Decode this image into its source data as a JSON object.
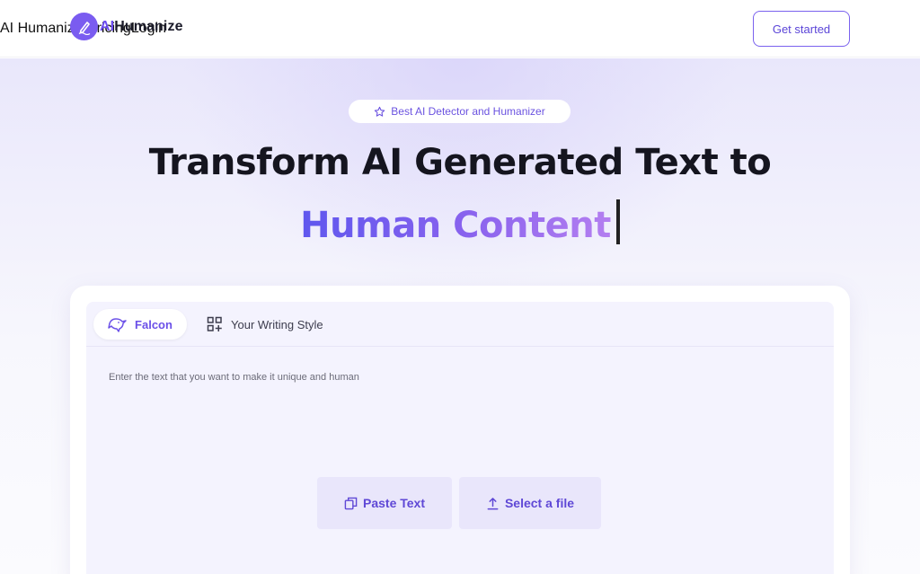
{
  "brand": {
    "name_prefix": "AI",
    "name_suffix": "Humanize"
  },
  "nav": {
    "items": [
      "AI Humanizer",
      "Pricing",
      "Login"
    ],
    "cta_label": "Get started"
  },
  "hero": {
    "badge_label": "Best AI Detector and Humanizer",
    "title_line1": "Transform AI Generated Text to",
    "title_line2": "Human Content"
  },
  "editor": {
    "tabs": [
      {
        "label": "Falcon",
        "icon": "falcon-icon",
        "active": true
      },
      {
        "label": "Your Writing Style",
        "icon": "grid-plus-icon",
        "active": false
      }
    ],
    "placeholder": "Enter the text that you want to make it unique and human",
    "actions": {
      "paste_label": "Paste Text",
      "file_label": "Select a file"
    }
  },
  "colors": {
    "accent": "#6c4df0",
    "gradient_start": "#5f57ee",
    "gradient_end": "#b47ff0",
    "editor_bg": "#f4f3fe",
    "button_bg": "#e9e6fb"
  }
}
